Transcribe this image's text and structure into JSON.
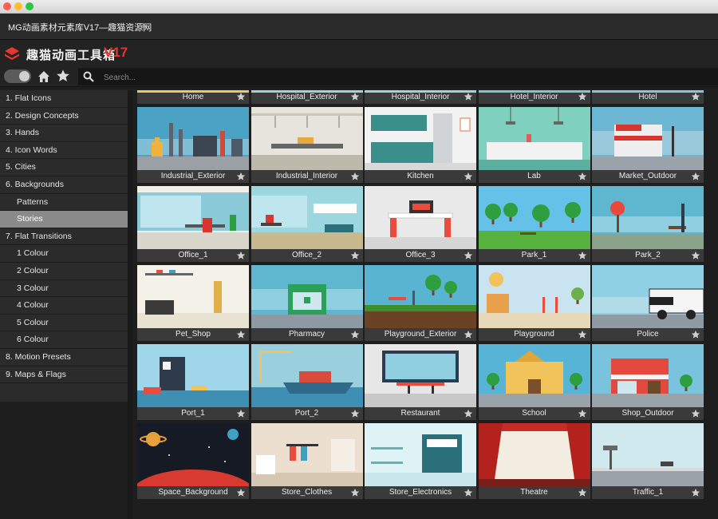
{
  "window": {
    "panel_title": "MG动画素材元素库V17—趣猫资源网",
    "menu_icon": "hamburger-icon",
    "traffic_lights": [
      "#fe5f57",
      "#febc2e",
      "#28c840"
    ]
  },
  "logo": {
    "text": "趣猫动画工具箱",
    "version": "V17",
    "accent": "#e8352f"
  },
  "toolbar": {
    "search_placeholder": "Search..."
  },
  "sidebar": {
    "items": [
      {
        "label": "1. Flat Icons",
        "sub": false,
        "active": false
      },
      {
        "label": "2. Design Concepts",
        "sub": false,
        "active": false
      },
      {
        "label": "3. Hands",
        "sub": false,
        "active": false
      },
      {
        "label": "4. Icon Words",
        "sub": false,
        "active": false
      },
      {
        "label": "5. Cities",
        "sub": false,
        "active": false
      },
      {
        "label": "6. Backgrounds",
        "sub": false,
        "active": false
      },
      {
        "label": "Patterns",
        "sub": true,
        "active": false
      },
      {
        "label": "Stories",
        "sub": true,
        "active": true
      },
      {
        "label": "7. Flat Transitions",
        "sub": false,
        "active": false
      },
      {
        "label": "1 Colour",
        "sub": true,
        "active": false
      },
      {
        "label": "2 Colour",
        "sub": true,
        "active": false
      },
      {
        "label": "3 Colour",
        "sub": true,
        "active": false
      },
      {
        "label": "4 Colour",
        "sub": true,
        "active": false
      },
      {
        "label": "5 Colour",
        "sub": true,
        "active": false
      },
      {
        "label": "6 Colour",
        "sub": true,
        "active": false
      },
      {
        "label": "8. Motion Presets",
        "sub": false,
        "active": false
      },
      {
        "label": "9. Maps & Flags",
        "sub": false,
        "active": false
      }
    ]
  },
  "grid": {
    "top_row": [
      {
        "label": "Home",
        "accent": "#e8c86a"
      },
      {
        "label": "Hospital_Exterior",
        "accent": "#9fd3d9"
      },
      {
        "label": "Hospital_Interior",
        "accent": "#9fd3d9"
      },
      {
        "label": "Hotel_Interior",
        "accent": "#7cc6d0"
      },
      {
        "label": "Hotel",
        "accent": "#8fc2d8"
      }
    ],
    "tiles": [
      {
        "label": "Industrial_Exterior",
        "scene": "industrial",
        "bg": "#4aa3c4"
      },
      {
        "label": "Industrial_Interior",
        "scene": "factory",
        "bg": "#e6e4dc"
      },
      {
        "label": "Kitchen",
        "scene": "kitchen",
        "bg": "#f2f2f2"
      },
      {
        "label": "Lab",
        "scene": "lab",
        "bg": "#7fd0bf"
      },
      {
        "label": "Market_Outdoor",
        "scene": "market",
        "bg": "#6cb7d4"
      },
      {
        "label": "Office_1",
        "scene": "office1",
        "bg": "#f1efe6"
      },
      {
        "label": "Office_2",
        "scene": "office2",
        "bg": "#9cd7df"
      },
      {
        "label": "Office_3",
        "scene": "office3",
        "bg": "#e9e9e9"
      },
      {
        "label": "Park_1",
        "scene": "park1",
        "bg": "#66c1e8"
      },
      {
        "label": "Park_2",
        "scene": "park2",
        "bg": "#5fb7cf"
      },
      {
        "label": "Pet_Shop",
        "scene": "petshop",
        "bg": "#f4f1e8"
      },
      {
        "label": "Pharmacy",
        "scene": "pharmacy",
        "bg": "#5fb7cf"
      },
      {
        "label": "Playground_Exterior",
        "scene": "playground_ext",
        "bg": "#58b4d0"
      },
      {
        "label": "Playground",
        "scene": "playground",
        "bg": "#c9e3f0"
      },
      {
        "label": "Police",
        "scene": "police",
        "bg": "#8fd0e4"
      },
      {
        "label": "Port_1",
        "scene": "port1",
        "bg": "#9fd6ea"
      },
      {
        "label": "Port_2",
        "scene": "port2",
        "bg": "#9ad0de"
      },
      {
        "label": "Restaurant",
        "scene": "restaurant",
        "bg": "#e7e7e7"
      },
      {
        "label": "School",
        "scene": "school",
        "bg": "#58b4d6"
      },
      {
        "label": "Shop_Outdoor",
        "scene": "shop",
        "bg": "#7ac3dc"
      },
      {
        "label": "Space_Background",
        "scene": "space",
        "bg": "#161a24"
      },
      {
        "label": "Store_Clothes",
        "scene": "clothes",
        "bg": "#ecdfd0"
      },
      {
        "label": "Store_Electronics",
        "scene": "electronics",
        "bg": "#dff3f6"
      },
      {
        "label": "Theatre",
        "scene": "theatre",
        "bg": "#c92b25"
      },
      {
        "label": "Traffic_1",
        "scene": "traffic",
        "bg": "#cfe9ee"
      }
    ]
  },
  "icons": {
    "home": "home-icon",
    "favorites": "star-icon",
    "search": "search-icon",
    "tile_favorite": "star-icon"
  }
}
